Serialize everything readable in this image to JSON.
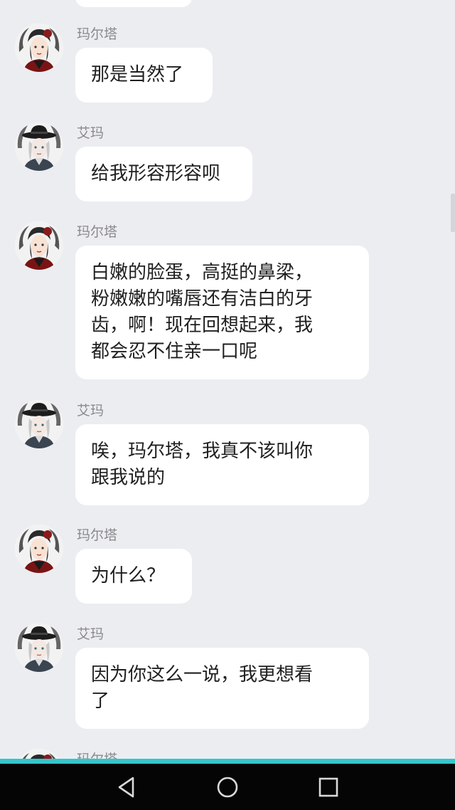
{
  "colors": {
    "background": "#ecedf1",
    "bubble": "#ffffff",
    "sender_text": "#8a8a8a",
    "message_text": "#1f1f1f",
    "accent_line": "#34c6cc",
    "nav_bar": "#050505",
    "nav_icon": "#d9d9d9"
  },
  "messages": [
    {
      "sender": "玛尔塔",
      "avatar": "marta-avatar",
      "lines": [
        "那是当然了"
      ]
    },
    {
      "sender": "艾玛",
      "avatar": "emma-avatar",
      "lines": [
        "给我形容形容呗"
      ]
    },
    {
      "sender": "玛尔塔",
      "avatar": "marta-avatar",
      "lines": [
        "白嫩的脸蛋，高挺的鼻梁，",
        "粉嫩嫩的嘴唇还有洁白的牙",
        "齿，啊！现在回想起来，我",
        "都会忍不住亲一口呢"
      ]
    },
    {
      "sender": "艾玛",
      "avatar": "emma-avatar",
      "lines": [
        "唉，玛尔塔，我真不该叫你",
        "跟我说的"
      ]
    },
    {
      "sender": "玛尔塔",
      "avatar": "marta-avatar",
      "lines": [
        "为什么？"
      ]
    },
    {
      "sender": "艾玛",
      "avatar": "emma-avatar",
      "lines": [
        "因为你这么一说，我更想看",
        "了"
      ]
    },
    {
      "sender": "玛尔塔",
      "avatar": "marta-avatar",
      "lines": []
    }
  ],
  "nav": {
    "back": "back-icon",
    "home": "home-icon",
    "recents": "recents-icon"
  }
}
